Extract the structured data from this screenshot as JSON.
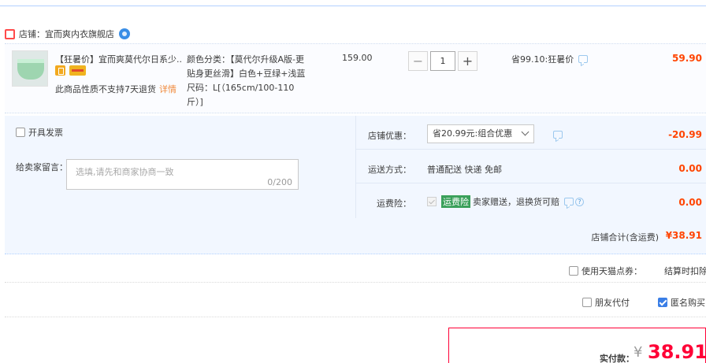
{
  "shop": {
    "label": "店铺：",
    "name": "宜而爽内衣旗舰店"
  },
  "item": {
    "title": "【狂暑价】宜而爽莫代尔日系少...",
    "no_return_text": "此商品性质不支持7天退货",
    "detail_link": "详情",
    "sku_line1": "颜色分类：【莫代尔升级A版-更",
    "sku_line2": "贴身更丝滑】白色+豆绿+浅蓝",
    "sku_line3": "尺码：L[（165cm/100-110",
    "sku_line4": "斤）]",
    "unit_price": "159.00",
    "quantity": "1",
    "qty_minus": "−",
    "qty_plus": "+",
    "promo": "省99.10:狂暑价",
    "subtotal": "59.90"
  },
  "options": {
    "invoice_label": "开具发票",
    "message_label": "给卖家留言：",
    "message_placeholder": "选填,请先和商家协商一致",
    "message_count": "0/200",
    "shop_discount_label": "店铺优惠：",
    "shop_discount_select": "省20.99元:组合优惠",
    "shop_discount_amount": "-20.99",
    "shipping_label": "运送方式：",
    "shipping_value": "普通配送 快递 免邮",
    "shipping_amount": "0.00",
    "insurance_label": "运费险：",
    "insurance_tag": "运费险",
    "insurance_text": "卖家赠送，退换货可赔",
    "insurance_amount": "0.00"
  },
  "shop_total": {
    "label": "店铺合计(含运费)",
    "amount": "¥38.91"
  },
  "tmall_points": {
    "label": "使用天猫点券：",
    "deduct_text": "结算时扣除"
  },
  "friend_pay": {
    "label": "朋友代付",
    "anonymous_label": "匿名购买",
    "anonymous_checked": true
  },
  "payment": {
    "label": "实付款：",
    "currency": "¥",
    "amount": "38.91"
  },
  "colors": {
    "price_red": "#ff4400",
    "pay_red": "#ff0036",
    "panel_blue": "#f2f7ff",
    "accent_blue": "#3a7ee6"
  }
}
